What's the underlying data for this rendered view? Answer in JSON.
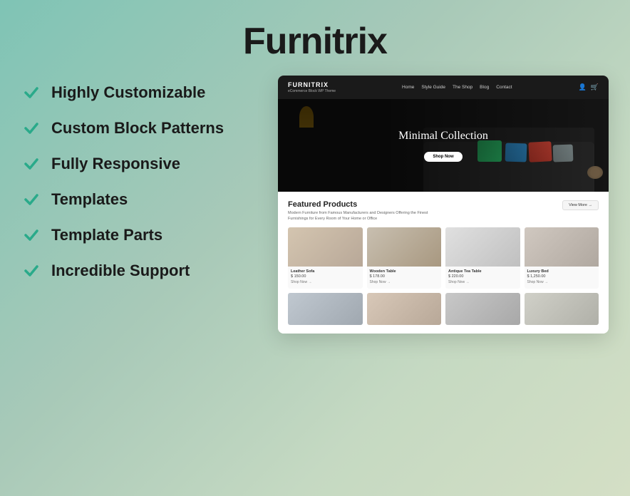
{
  "page": {
    "title": "Furnitrix",
    "background": "gradient teal to sage green"
  },
  "features": {
    "items": [
      {
        "id": "highly-customizable",
        "label": "Highly Customizable"
      },
      {
        "id": "custom-block-patterns",
        "label": "Custom Block Patterns"
      },
      {
        "id": "fully-responsive",
        "label": "Fully Responsive"
      },
      {
        "id": "templates",
        "label": "Templates"
      },
      {
        "id": "template-parts",
        "label": "Template Parts"
      },
      {
        "id": "incredible-support",
        "label": "Incredible Support"
      }
    ]
  },
  "preview": {
    "nav": {
      "logo": "FURNITRIX",
      "logo_sub": "eCommerce Block WP Theme",
      "links": [
        "Home",
        "Style Guide",
        "The Shop",
        "Blog",
        "Contact"
      ]
    },
    "hero": {
      "title": "Minimal Collection",
      "button_label": "Shop Now"
    },
    "featured": {
      "title": "Featured Products",
      "description": "Modern Furniture from Famous Manufacturers and Designers Offering the Finest Furnishings for Every Room of Your Home or Office",
      "view_more": "View More →",
      "products": [
        {
          "name": "Leather Sofa",
          "price": "$ 150.00",
          "shop": "Shop Now →"
        },
        {
          "name": "Wooden Table",
          "price": "$ 178.00",
          "shop": "Shop Now →"
        },
        {
          "name": "Antique Tea Table",
          "price": "$ 220.00",
          "shop": "Shop Now →"
        },
        {
          "name": "Luxury Bed",
          "price": "$ 1,250.00",
          "shop": "Shop Now →"
        }
      ]
    }
  },
  "colors": {
    "check_teal": "#2aaa8a",
    "title_dark": "#1a1a1a",
    "bg_gradient_start": "#7fc4b5",
    "bg_gradient_end": "#c5d9c2"
  },
  "icons": {
    "checkmark": "✓",
    "user": "👤",
    "cart": "🛒"
  }
}
